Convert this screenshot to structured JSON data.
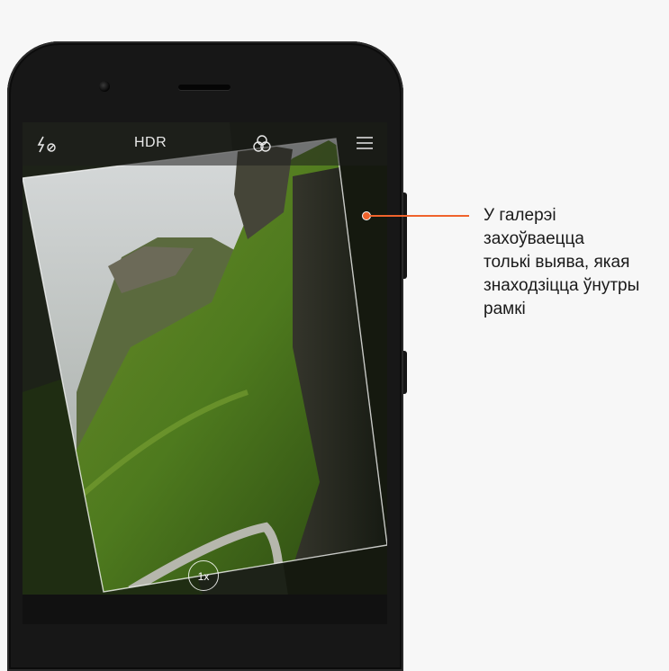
{
  "camera": {
    "hdr_label": "HDR",
    "zoom_label": "1x",
    "icons": [
      "flash-auto-icon",
      "hdr-icon",
      "filters-icon",
      "menu-icon"
    ]
  },
  "callout": {
    "text": "У галерэі\nзахоўваецца\nтолькі выява, якая\nзнаходзіцца ўнутры\nрамкі",
    "accent_color": "#f0632c"
  }
}
